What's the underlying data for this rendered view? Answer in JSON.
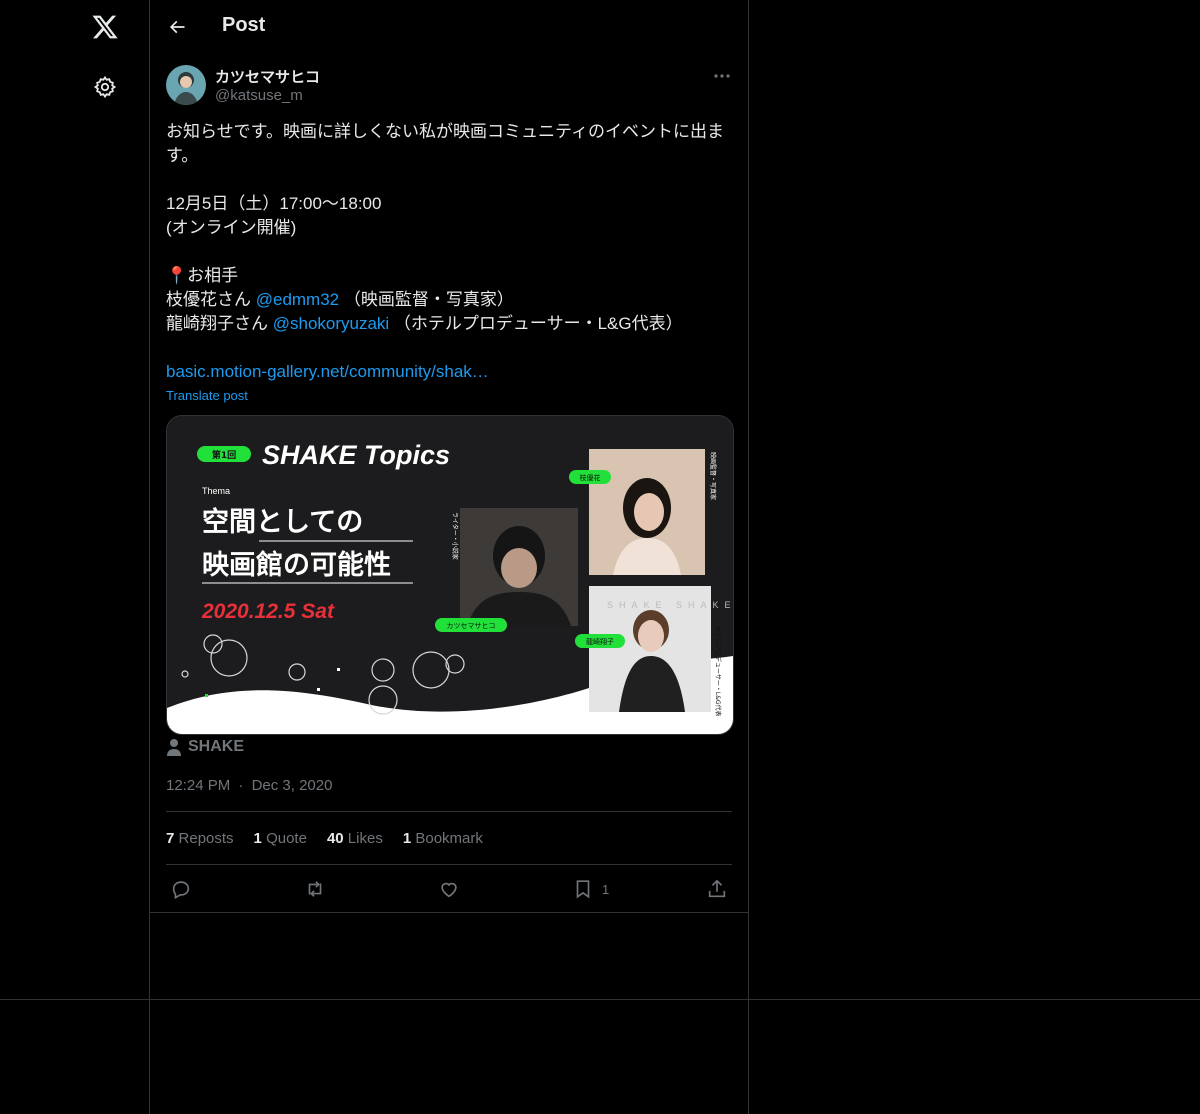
{
  "header": {
    "title": "Post"
  },
  "author": {
    "display_name": "カツセマサヒコ",
    "handle": "@katsuse_m"
  },
  "post": {
    "line1": "お知らせです。映画に詳しくない私が映画コミュニティのイベントに出ます。",
    "date_line": "12月5日（土）17:00〜18:00",
    "format_line": "(オンライン開催)",
    "pin_emoji": "📍",
    "guests_heading": "お相手",
    "guest1_name": "枝優花さん ",
    "guest1_mention": "@edmm32",
    "guest1_role": " （映画監督・写真家）",
    "guest2_name": "龍崎翔子さん ",
    "guest2_mention": "@shokoryuzaki",
    "guest2_role": " （ホテルプロデューサー・L&G代表）",
    "link": "basic.motion-gallery.net/community/shak…",
    "translate": "Translate post"
  },
  "media": {
    "badge": "第1回",
    "brand": "SHAKE Topics",
    "thema_label": "Thema",
    "headline1": "空間としての",
    "headline2": "映画館の可能性",
    "event_date": "2020.12.5 Sat",
    "person1_tag": "カツセマサヒコ",
    "person1_role": "ライター・小説家",
    "person2_tag": "枝優花",
    "person2_role": "映画監督・写真家",
    "person3_tag": "龍崎翔子",
    "person3_role": "ホテルプロデューサー・L&G代表"
  },
  "tagged_account": "SHAKE",
  "timestamp": {
    "time": "12:24 PM",
    "separator": "·",
    "date": "Dec 3, 2020"
  },
  "stats": {
    "reposts_count": "7",
    "reposts_label": "Reposts",
    "quotes_count": "1",
    "quotes_label": "Quote",
    "likes_count": "40",
    "likes_label": "Likes",
    "bookmarks_count": "1",
    "bookmarks_label": "Bookmark"
  },
  "actions": {
    "bookmark_count": "1"
  },
  "icons": [
    "x-logo-icon",
    "settings-icon",
    "back-arrow-icon",
    "more-icon",
    "person-icon",
    "reply-icon",
    "repost-icon",
    "like-icon",
    "bookmark-icon",
    "share-icon"
  ],
  "colors": {
    "background": "#000000",
    "text": "#e7e9ea",
    "muted": "#71767b",
    "link": "#1d9bf0",
    "border": "#2f3336",
    "accent_green": "#22e03a",
    "date_red": "#e8303a"
  }
}
